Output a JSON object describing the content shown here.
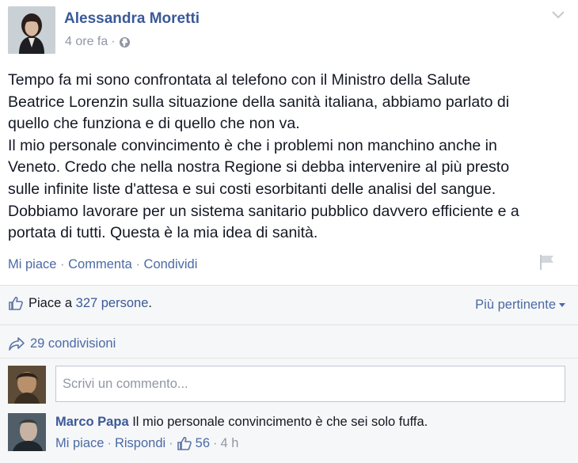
{
  "post": {
    "author": "Alessandra Moretti",
    "time": "4 ore fa",
    "separator": "·",
    "privacy_icon": "globe-icon",
    "lines": [
      "Tempo fa mi sono confrontata al telefono con il Ministro della Salute",
      "Beatrice Lorenzin sulla situazione della sanità italiana, abbiamo parlato di",
      "quello che funziona e di quello che non va.",
      "Il mio personale convincimento è che i problemi non manchino anche in",
      "Veneto. Credo che nella nostra Regione si debba intervenire al più presto",
      "sulle infinite liste d'attesa e sui costi esorbitanti delle analisi del sangue.",
      "Dobbiamo lavorare per un sistema sanitario pubblico davvero efficiente e a",
      "portata di tutti. Questa è la mia idea di sanità."
    ]
  },
  "actions": {
    "like": "Mi piace",
    "comment": "Commenta",
    "share": "Condividi",
    "sep": "·"
  },
  "feedback": {
    "likes_prefix": "Piace a",
    "likes_link": "327 persone",
    "likes_suffix": ".",
    "sort_label": "Più pertinente",
    "shares": "29 condivisioni",
    "comment_placeholder": "Scrivi un commento..."
  },
  "comment": {
    "author": "Marco Papa",
    "text": "Il mio personale convincimento è che sei solo fuffa.",
    "like": "Mi piace",
    "reply": "Rispondi",
    "like_count": "56",
    "time": "4 h",
    "sep": "·"
  },
  "colors": {
    "link": "#3b5998",
    "muted": "#9197a3",
    "feedback_bg": "#f6f7f8"
  }
}
